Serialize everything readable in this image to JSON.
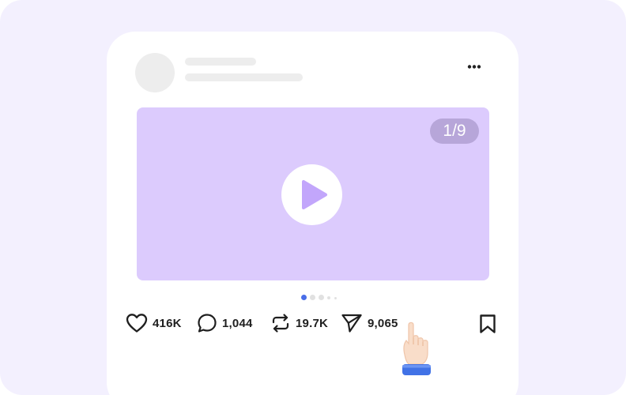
{
  "media": {
    "counter": "1/9",
    "background": "#dccbfd",
    "page_dots": 5,
    "active_dot": 0,
    "accent": "#4a6ee8"
  },
  "actions": {
    "likes": "416K",
    "comments": "1,044",
    "reposts": "19.7K",
    "shares": "9,065"
  },
  "icons": {
    "menu": "more-dots-icon",
    "play": "play-icon",
    "like": "heart-icon",
    "comment": "comment-bubble-icon",
    "repost": "repost-icon",
    "share": "send-icon",
    "save": "bookmark-icon",
    "pointer": "pointing-hand-icon"
  }
}
